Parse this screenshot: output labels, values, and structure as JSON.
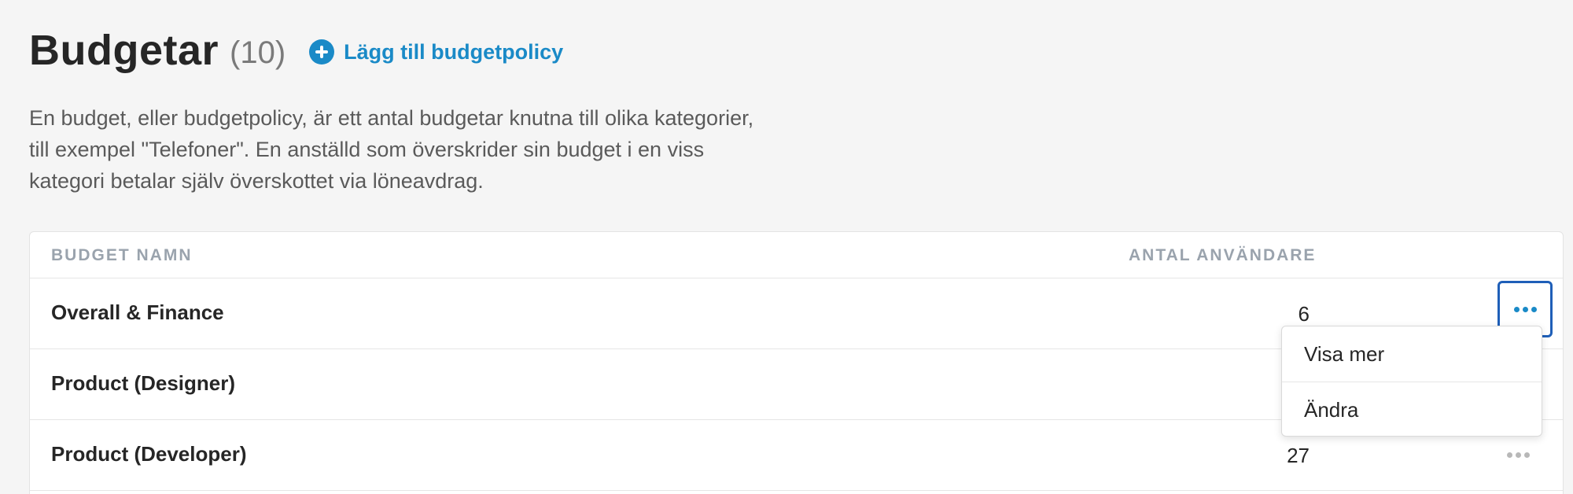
{
  "header": {
    "title": "Budgetar",
    "count": "(10)",
    "add_label": "Lägg till budgetpolicy"
  },
  "description": {
    "line1": "En budget, eller budgetpolicy, är ett antal budgetar knutna till olika kategorier,",
    "line2": "till exempel \"Telefoner\". En anställd som överskrider sin budget i en viss",
    "line3": "kategori betalar själv överskottet via löneavdrag."
  },
  "table": {
    "columns": {
      "name": "BUDGET NAMN",
      "users": "ANTAL ANVÄNDARE"
    },
    "rows": [
      {
        "name": "Overall & Finance",
        "users": "6"
      },
      {
        "name": "Product (Designer)",
        "users": ""
      },
      {
        "name": "Product (Developer)",
        "users": "27"
      }
    ]
  },
  "menu": {
    "items": [
      "Visa mer",
      "Ändra"
    ]
  },
  "colors": {
    "accent": "#1a8ac7",
    "focus_border": "#1f5fb8",
    "header_text": "#9aa3ad"
  },
  "icons": {
    "add": "plus-circle-icon",
    "more": "ellipsis-icon"
  }
}
